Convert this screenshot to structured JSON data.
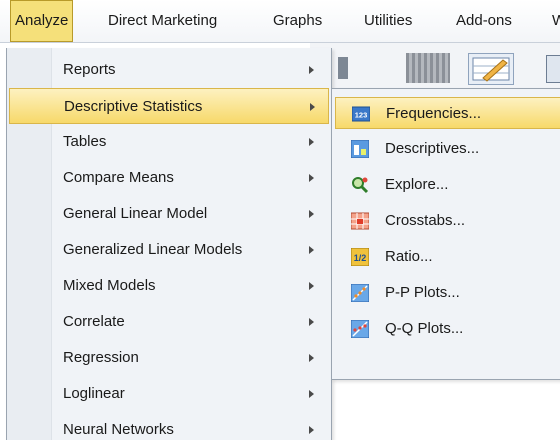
{
  "menubar": {
    "items": [
      {
        "label": "Analyze",
        "active": true
      },
      {
        "label": "Direct Marketing"
      },
      {
        "label": "Graphs"
      },
      {
        "label": "Utilities"
      },
      {
        "label": "Add-ons"
      },
      {
        "label": "W"
      }
    ]
  },
  "analyze_menu": {
    "items": [
      {
        "label": "Reports",
        "has_submenu": true
      },
      {
        "label": "Descriptive Statistics",
        "has_submenu": true,
        "highlighted": true
      },
      {
        "label": "Tables",
        "has_submenu": true
      },
      {
        "label": "Compare Means",
        "has_submenu": true
      },
      {
        "label": "General Linear Model",
        "has_submenu": true
      },
      {
        "label": "Generalized Linear Models",
        "has_submenu": true
      },
      {
        "label": "Mixed Models",
        "has_submenu": true
      },
      {
        "label": "Correlate",
        "has_submenu": true
      },
      {
        "label": "Regression",
        "has_submenu": true
      },
      {
        "label": "Loglinear",
        "has_submenu": true
      },
      {
        "label": "Neural Networks",
        "has_submenu": true
      }
    ]
  },
  "descriptive_submenu": {
    "items": [
      {
        "label": "Frequencies...",
        "icon": "frequencies-icon",
        "highlighted": true
      },
      {
        "label": "Descriptives...",
        "icon": "descriptives-icon"
      },
      {
        "label": "Explore...",
        "icon": "explore-icon"
      },
      {
        "label": "Crosstabs...",
        "icon": "crosstabs-icon"
      },
      {
        "label": "Ratio...",
        "icon": "ratio-icon"
      },
      {
        "label": "P-P Plots...",
        "icon": "pp-plots-icon"
      },
      {
        "label": "Q-Q Plots...",
        "icon": "qq-plots-icon"
      }
    ]
  },
  "icon_text": {
    "frequencies": "123",
    "ratio": "1/2"
  },
  "colors": {
    "highlight": "#f7d96a",
    "menu_bg": "#f0f3f7",
    "icon_blue": "#3a78c9"
  }
}
